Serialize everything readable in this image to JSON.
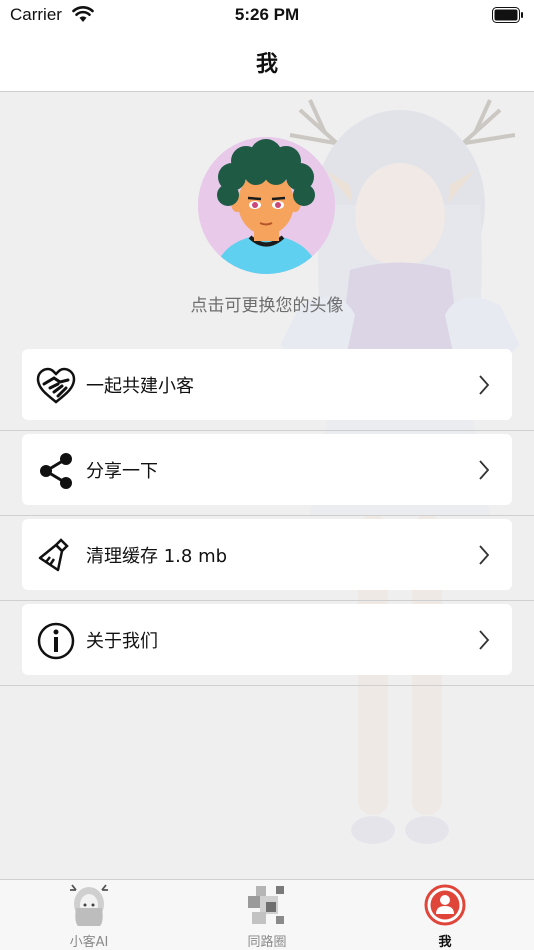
{
  "status_bar": {
    "carrier": "Carrier",
    "time": "5:26 PM"
  },
  "nav": {
    "title": "我"
  },
  "profile": {
    "avatar_hint": "点击可更换您的头像"
  },
  "menu": {
    "items": [
      {
        "label": "一起共建小客",
        "icon": "handshake-heart-icon"
      },
      {
        "label": "分享一下",
        "icon": "share-icon"
      },
      {
        "label": "清理缓存 1.8 mb",
        "icon": "broom-icon"
      },
      {
        "label": "关于我们",
        "icon": "info-icon"
      }
    ]
  },
  "tabs": [
    {
      "label": "小客AI",
      "icon": "anime-girl-icon",
      "active": false
    },
    {
      "label": "同路圈",
      "icon": "grid-blocks-icon",
      "active": false
    },
    {
      "label": "我",
      "icon": "user-icon",
      "active": true
    }
  ],
  "colors": {
    "accent": "#e0453a",
    "avatar_bg": "#e8c9ea",
    "background": "#efefef"
  }
}
